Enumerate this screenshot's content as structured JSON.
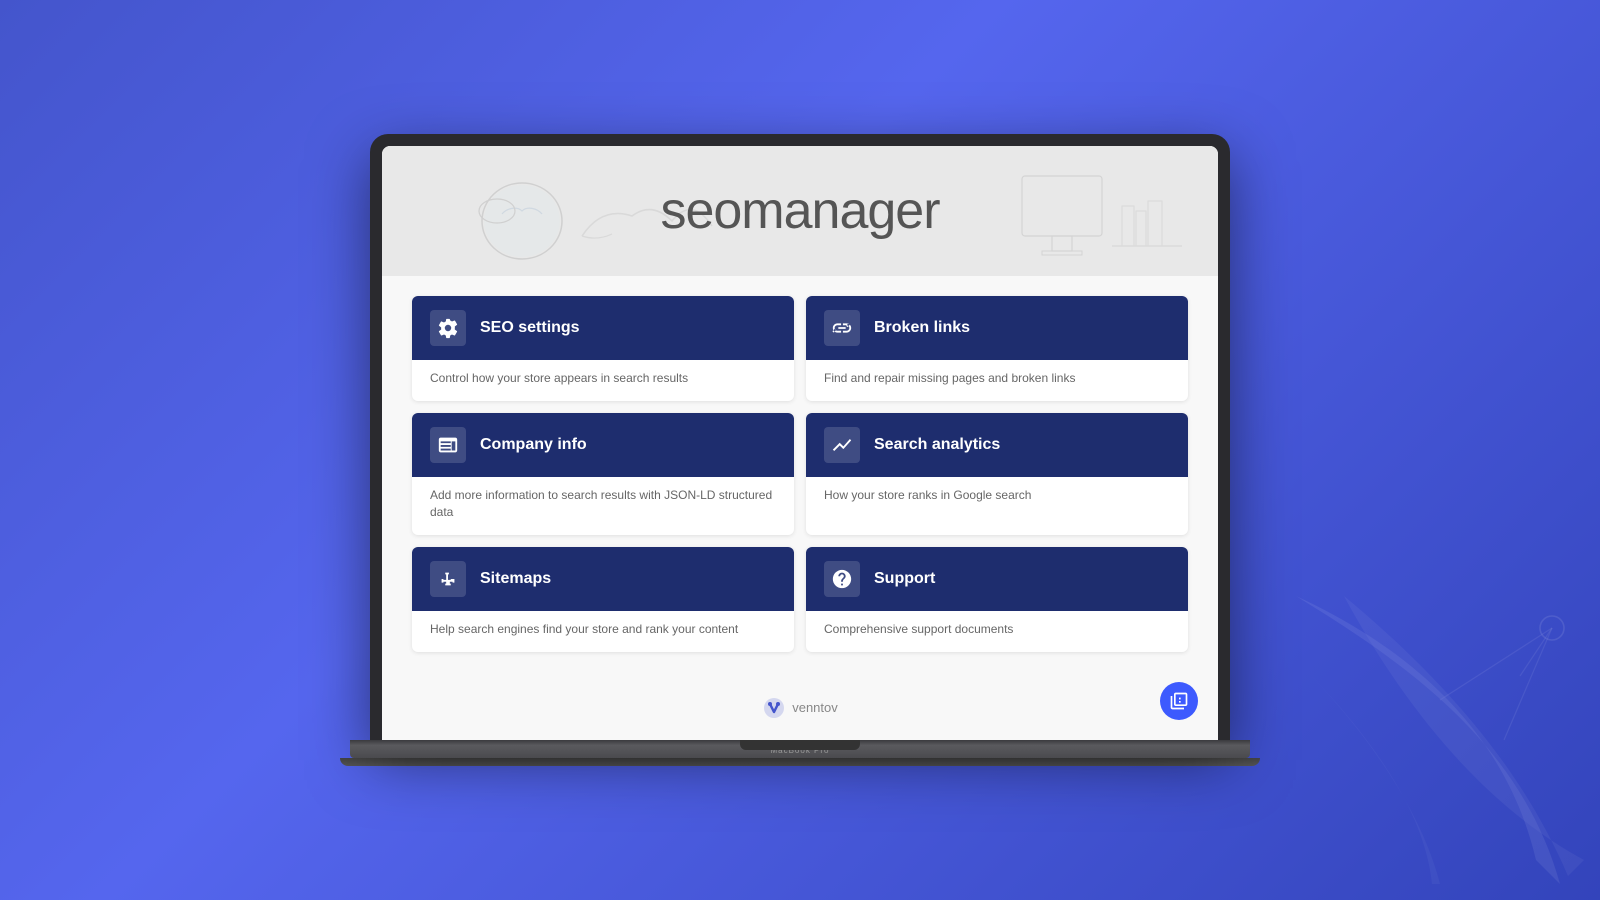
{
  "app": {
    "title": "seomanager",
    "title_seo": "seo",
    "title_manager": "manager",
    "branding": "venntov",
    "macbook_label": "MacBook Pro"
  },
  "menu": {
    "cards": [
      {
        "id": "seo-settings",
        "title": "SEO settings",
        "description": "Control how your store appears in search results",
        "icon": "gear"
      },
      {
        "id": "broken-links",
        "title": "Broken links",
        "description": "Find and repair missing pages and broken links",
        "icon": "broken-link"
      },
      {
        "id": "company-info",
        "title": "Company info",
        "description": "Add more information to search results with JSON-LD structured data",
        "icon": "company"
      },
      {
        "id": "search-analytics",
        "title": "Search analytics",
        "description": "How your store ranks in Google search",
        "icon": "analytics"
      },
      {
        "id": "sitemaps",
        "title": "Sitemaps",
        "description": "Help search engines find your store and rank your content",
        "icon": "sitemap"
      },
      {
        "id": "support",
        "title": "Support",
        "description": "Comprehensive support documents",
        "icon": "support"
      }
    ]
  },
  "help_button": {
    "label": "help"
  }
}
